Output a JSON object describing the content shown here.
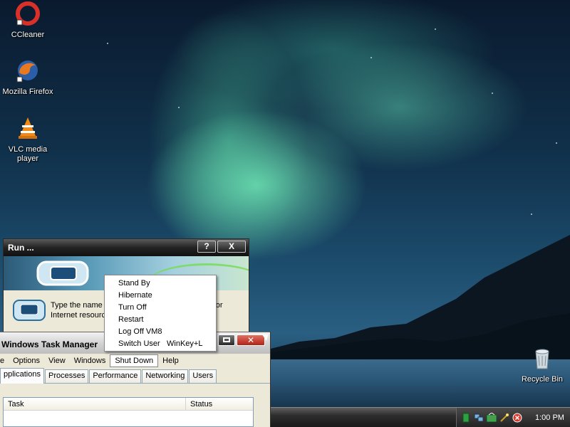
{
  "desktop": {
    "icons": [
      {
        "label": "CCleaner",
        "icon": "ccleaner-icon"
      },
      {
        "label": "Mozilla Firefox",
        "icon": "firefox-icon"
      },
      {
        "label": "VLC media player",
        "icon": "vlc-icon"
      },
      {
        "label": "Recycle Bin",
        "icon": "recycle-bin-icon"
      }
    ]
  },
  "run_dialog": {
    "title": "Run ...",
    "help_btn": "?",
    "close_btn": "X",
    "prompt_line1": "Type the name of a program, folder, document, or",
    "prompt_line2": "Internet resource"
  },
  "shutdown_menu": {
    "items": [
      {
        "label": "Stand By",
        "accel": ""
      },
      {
        "label": "Hibernate",
        "accel": ""
      },
      {
        "label": "Turn Off",
        "accel": ""
      },
      {
        "label": "Restart",
        "accel": ""
      },
      {
        "label": "Log Off VM8",
        "accel": ""
      },
      {
        "label": "Switch User",
        "accel": "WinKey+L"
      }
    ]
  },
  "task_manager": {
    "title": "Windows Task Manager",
    "menus": [
      "e",
      "Options",
      "View",
      "Windows",
      "Shut Down",
      "Help"
    ],
    "active_menu": "Shut Down",
    "tabs": [
      "pplications",
      "Processes",
      "Performance",
      "Networking",
      "Users"
    ],
    "active_tab": "pplications",
    "columns": [
      "Task",
      "Status"
    ]
  },
  "taskbar": {
    "clock": "1:00 PM",
    "tray_icons": [
      "green-device-icon",
      "network-icon",
      "network-activity-icon",
      "wand-icon",
      "security-alert-icon"
    ]
  },
  "colors": {
    "aurora": "#6fe6b4",
    "titlebar_dark": "#232323",
    "dialog_bg": "#ece9d8",
    "close_red": "#c8352a"
  }
}
